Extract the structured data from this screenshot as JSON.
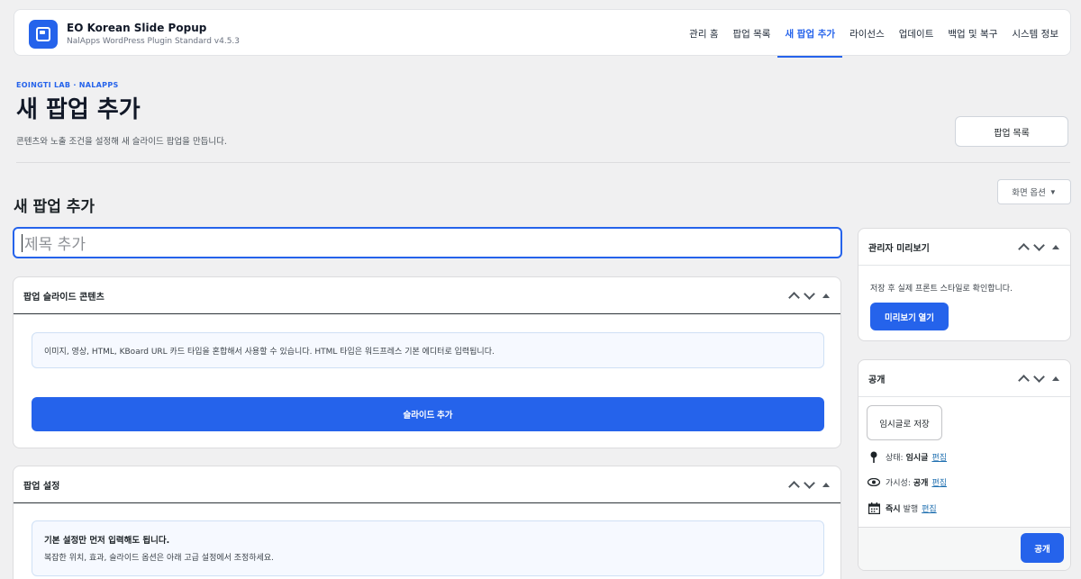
{
  "header": {
    "app_title": "EO Korean Slide Popup",
    "app_subtitle": "NalApps WordPress Plugin Standard v4.5.3",
    "nav": [
      {
        "label": "관리 홈",
        "active": false
      },
      {
        "label": "팝업 목록",
        "active": false
      },
      {
        "label": "새 팝업 추가",
        "active": true
      },
      {
        "label": "라이선스",
        "active": false
      },
      {
        "label": "업데이트",
        "active": false
      },
      {
        "label": "백업 및 복구",
        "active": false
      },
      {
        "label": "시스템 정보",
        "active": false
      }
    ]
  },
  "page": {
    "eyebrow": "EOINGTI LAB · NALAPPS",
    "title": "새 팝업 추가",
    "description": "콘텐츠와 노출 조건을 설정해 새 슬라이드 팝업을 만듭니다.",
    "list_button": "팝업 목록",
    "screen_options": "화면 옵션",
    "section_title": "새 팝업 추가",
    "title_placeholder": "제목 추가"
  },
  "slide_box": {
    "title": "팝업 슬라이드 콘텐츠",
    "info": "이미지, 영상, HTML, KBoard URL 카드 타입을 혼합해서 사용할 수 있습니다. HTML 타입은 워드프레스 기본 에디터로 입력됩니다.",
    "add_slide_button": "슬라이드 추가"
  },
  "settings_box": {
    "title": "팝업 설정",
    "info_title": "기본 설정만 먼저 입력해도 됩니다.",
    "info_text": "복잡한 위치, 효과, 슬라이드 옵션은 아래 고급 설정에서 조정하세요."
  },
  "preview_box": {
    "title": "관리자 미리보기",
    "text": "저장 후 실제 프론트 스타일로 확인합니다.",
    "button": "미리보기 열기"
  },
  "publish_box": {
    "title": "공개",
    "save_draft": "임시글로 저장",
    "status_label": "상태:",
    "status_value": "임시글",
    "visibility_label": "가시성:",
    "visibility_value": "공개",
    "publish_time_prefix": "즉시",
    "publish_time_label": "발행",
    "edit_link": "편집",
    "publish_button": "공개"
  },
  "colors": {
    "accent": "#2563eb",
    "background": "#f0f0f1",
    "link": "#2271b1"
  }
}
